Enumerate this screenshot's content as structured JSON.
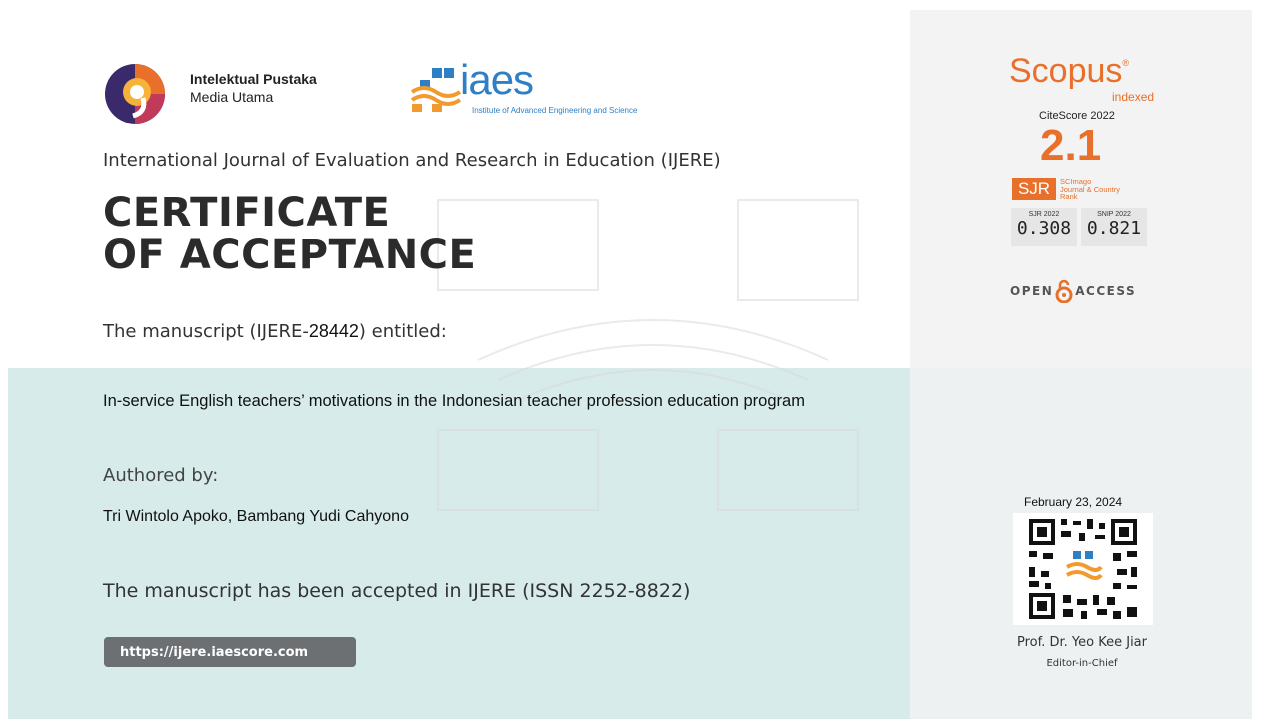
{
  "publisher": {
    "name_line1": "Intelektual Pustaka",
    "name_line2": "Media Utama",
    "partner_logo_word": "iaes",
    "partner_name": "Institute of Advanced Engineering and Science"
  },
  "certificate": {
    "journal": "International Journal of Evaluation and Research in Education (IJERE)",
    "title_line1": "CERTIFICATE",
    "title_line2": "OF ACCEPTANCE",
    "manuscript_prefix": "The manuscript (IJERE-",
    "manuscript_id": "28442",
    "manuscript_suffix": ") entitled:",
    "paper_title": "In-service English teachers’ motivations in the Indonesian teacher profession education program",
    "authored_label": "Authored by:",
    "authors": "Tri Wintolo Apoko, Bambang Yudi Cahyono",
    "accepted_statement": "The manuscript has been accepted in IJERE (ISSN 2252-8822)",
    "url": "https://ijere.iaescore.com"
  },
  "metrics": {
    "scopus": "Scopus",
    "scopus_mark": "®",
    "indexed": "indexed",
    "citescore_label": "CiteScore 2022",
    "citescore_value": "2.1",
    "sjr_badge": "SJR",
    "sjr_desc_line1": "SCImago",
    "sjr_desc_line2": "Journal & Country",
    "sjr_desc_line3": "Rank",
    "sjr_label": "SJR 2022",
    "sjr_value": "0.308",
    "snip_label": "SNIP 2022",
    "snip_value": "0.821",
    "open_access_left": "OPEN",
    "open_access_right": "ACCESS"
  },
  "signature": {
    "date": "February 23, 2024",
    "editor_name": "Prof. Dr. Yeo Kee Jiar",
    "editor_role": "Editor-in-Chief"
  },
  "colors": {
    "band": "#d6ebea",
    "accent": "#e8702a",
    "iaes_blue": "#2e7fc4",
    "button": "#6c7073"
  }
}
